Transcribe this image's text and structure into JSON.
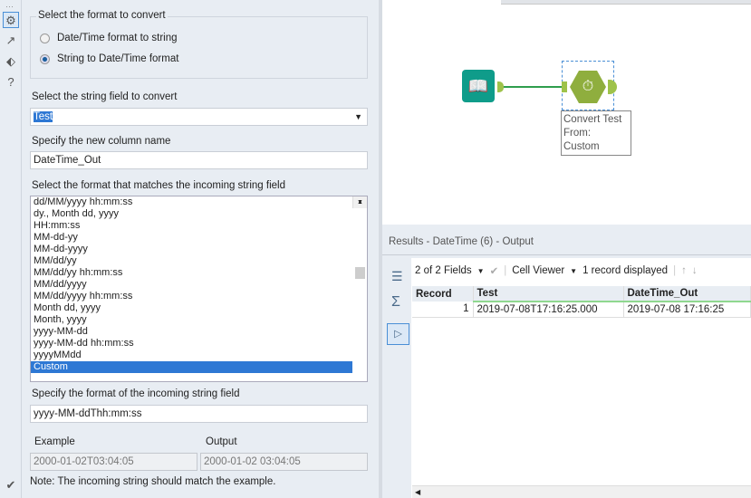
{
  "sidebar_icons": [
    "gear-icon",
    "connection-icon",
    "tag-icon",
    "help-icon"
  ],
  "config": {
    "format_group_label": "Select the format to convert",
    "radio_options": [
      {
        "label": "Date/Time format to string",
        "selected": false
      },
      {
        "label": "String to Date/Time format",
        "selected": true
      }
    ],
    "string_field_label": "Select the string field to convert",
    "string_field_value": "Test",
    "new_column_label": "Specify the new column name",
    "new_column_value": "DateTime_Out",
    "format_list_label": "Select the format that matches the incoming string field",
    "format_options": [
      "dd/MM/yyyy hh:mm:ss",
      "dy., Month dd, yyyy",
      "HH:mm:ss",
      "MM-dd-yy",
      "MM-dd-yyyy",
      "MM/dd/yy",
      "MM/dd/yy hh:mm:ss",
      "MM/dd/yyyy",
      "MM/dd/yyyy hh:mm:ss",
      "Month dd, yyyy",
      "Month, yyyy",
      "yyyy-MM-dd",
      "yyyy-MM-dd hh:mm:ss",
      "yyyyMMdd",
      "Custom"
    ],
    "selected_format": "Custom",
    "custom_format_label": "Specify the format of the incoming string field",
    "custom_format_value": "yyyy-MM-ddThh:mm:ss",
    "example_label": "Example",
    "output_label": "Output",
    "example_value": "2000-01-02T03:04:05",
    "output_value": "2000-01-02 03:04:05",
    "note": "Note: The incoming string should match the example."
  },
  "canvas": {
    "tool_annotation": [
      "Convert Test",
      "From:",
      "Custom"
    ]
  },
  "results": {
    "title": "Results - DateTime (6) - Output",
    "fields_label": "2 of 2 Fields",
    "cell_viewer_label": "Cell Viewer",
    "records_label": "1 record displayed",
    "columns": [
      "Record",
      "Test",
      "DateTime_Out"
    ],
    "rows": [
      [
        "1",
        "2019-07-08T17:16:25.000",
        "2019-07-08 17:16:25"
      ]
    ]
  }
}
